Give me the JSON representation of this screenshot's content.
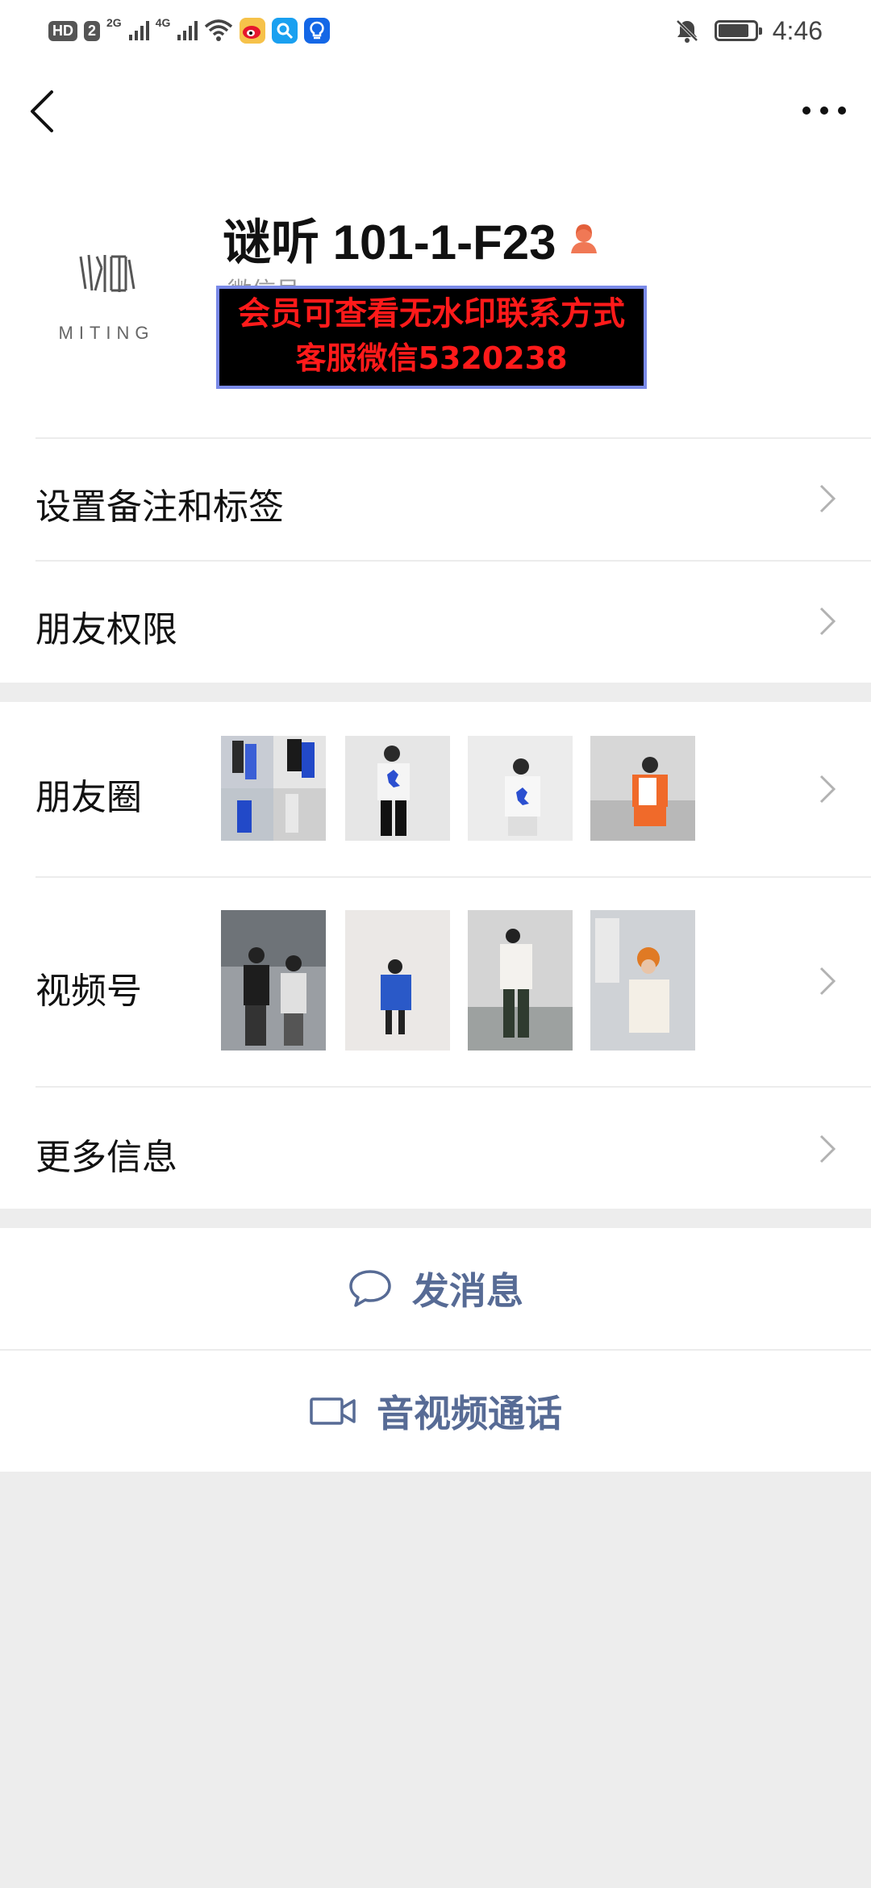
{
  "status_bar": {
    "hd_badge": "HD",
    "sim_slot": "2",
    "net_2g": "2G",
    "net_4g": "4G",
    "time": "4:46",
    "battery_level": 0.85
  },
  "nav": {
    "back_icon": "chevron-left-icon",
    "more_icon": "more-dots-icon"
  },
  "profile": {
    "avatar_text": "MITING",
    "avatar_logo": "谜听",
    "name": "谜听 101-1-F23",
    "gender_icon": "female-icon",
    "wechat_id_partial": "微信号",
    "watermark_line1": "会员可查看无水印联系方式",
    "watermark_line2": "客服微信5320238"
  },
  "rows": {
    "remark_tags": "设置备注和标签",
    "friend_permissions": "朋友权限",
    "moments": "朋友圈",
    "channels": "视频号",
    "more_info": "更多信息"
  },
  "actions": {
    "send_message": "发消息",
    "av_call": "音视频通话"
  },
  "colors": {
    "accent_link": "#576b95",
    "watermark_text": "#ff1a1a",
    "watermark_border": "#7a8ae8",
    "background": "#ededed"
  }
}
